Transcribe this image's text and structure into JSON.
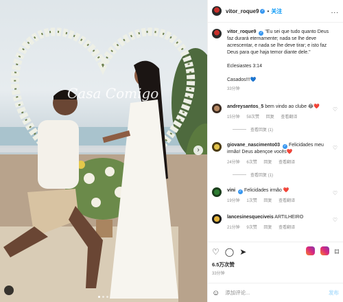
{
  "post": {
    "username": "vitor_roque9",
    "follow_label": "关注",
    "more_label": "...",
    "caption_user": "vitor_roque9",
    "caption_text": "\"Eu sei que tudo quanto Deus faz durará eternamente; nada se lhe deve acrescentar, e nada se lhe deve tirar; e isto faz Deus para que haja temor diante dele.\"",
    "caption_ref": "Eclesiastes 3:14",
    "caption_extra": "Casados!!!💙",
    "caption_time": "33分钟",
    "photo_sign_text": "Casa Comigo",
    "likes": "6.5万次赞",
    "date": "33分钟",
    "add_comment_placeholder": "添加评论...",
    "post_label": "发布"
  },
  "comments": [
    {
      "user": "andreysantos_5",
      "text": "bem vindo ao clube 😂❤️",
      "time": "15分钟",
      "likes": "58次赞",
      "reply": "回复",
      "translate": "查看翻译",
      "view_replies": "查看回复 (1)"
    },
    {
      "user": "giovane_nascimento03",
      "text": "Felicidades meu irmão! Deus abençoe vocês❤️",
      "time": "24分钟",
      "likes": "6次赞",
      "reply": "回复",
      "translate": "查看翻译",
      "view_replies": "查看回复 (1)"
    },
    {
      "user": "vini",
      "text": "Felicidades irmão ❤️",
      "time": "19分钟",
      "likes": "1次赞",
      "reply": "回复",
      "translate": "查看翻译",
      "view_replies": ""
    },
    {
      "user": "lancesinesqueciveis",
      "text": "ARTILHEIRO",
      "time": "21分钟",
      "likes": "9次赞",
      "reply": "回复",
      "translate": "查看翻译",
      "view_replies": ""
    }
  ],
  "icons": [
    "heart-icon",
    "comment-icon",
    "share-icon",
    "save-icon"
  ],
  "colors": {
    "accent": "#0095f6",
    "verified": "#3897f0",
    "text": "#262626",
    "muted": "#8e8e8e"
  }
}
